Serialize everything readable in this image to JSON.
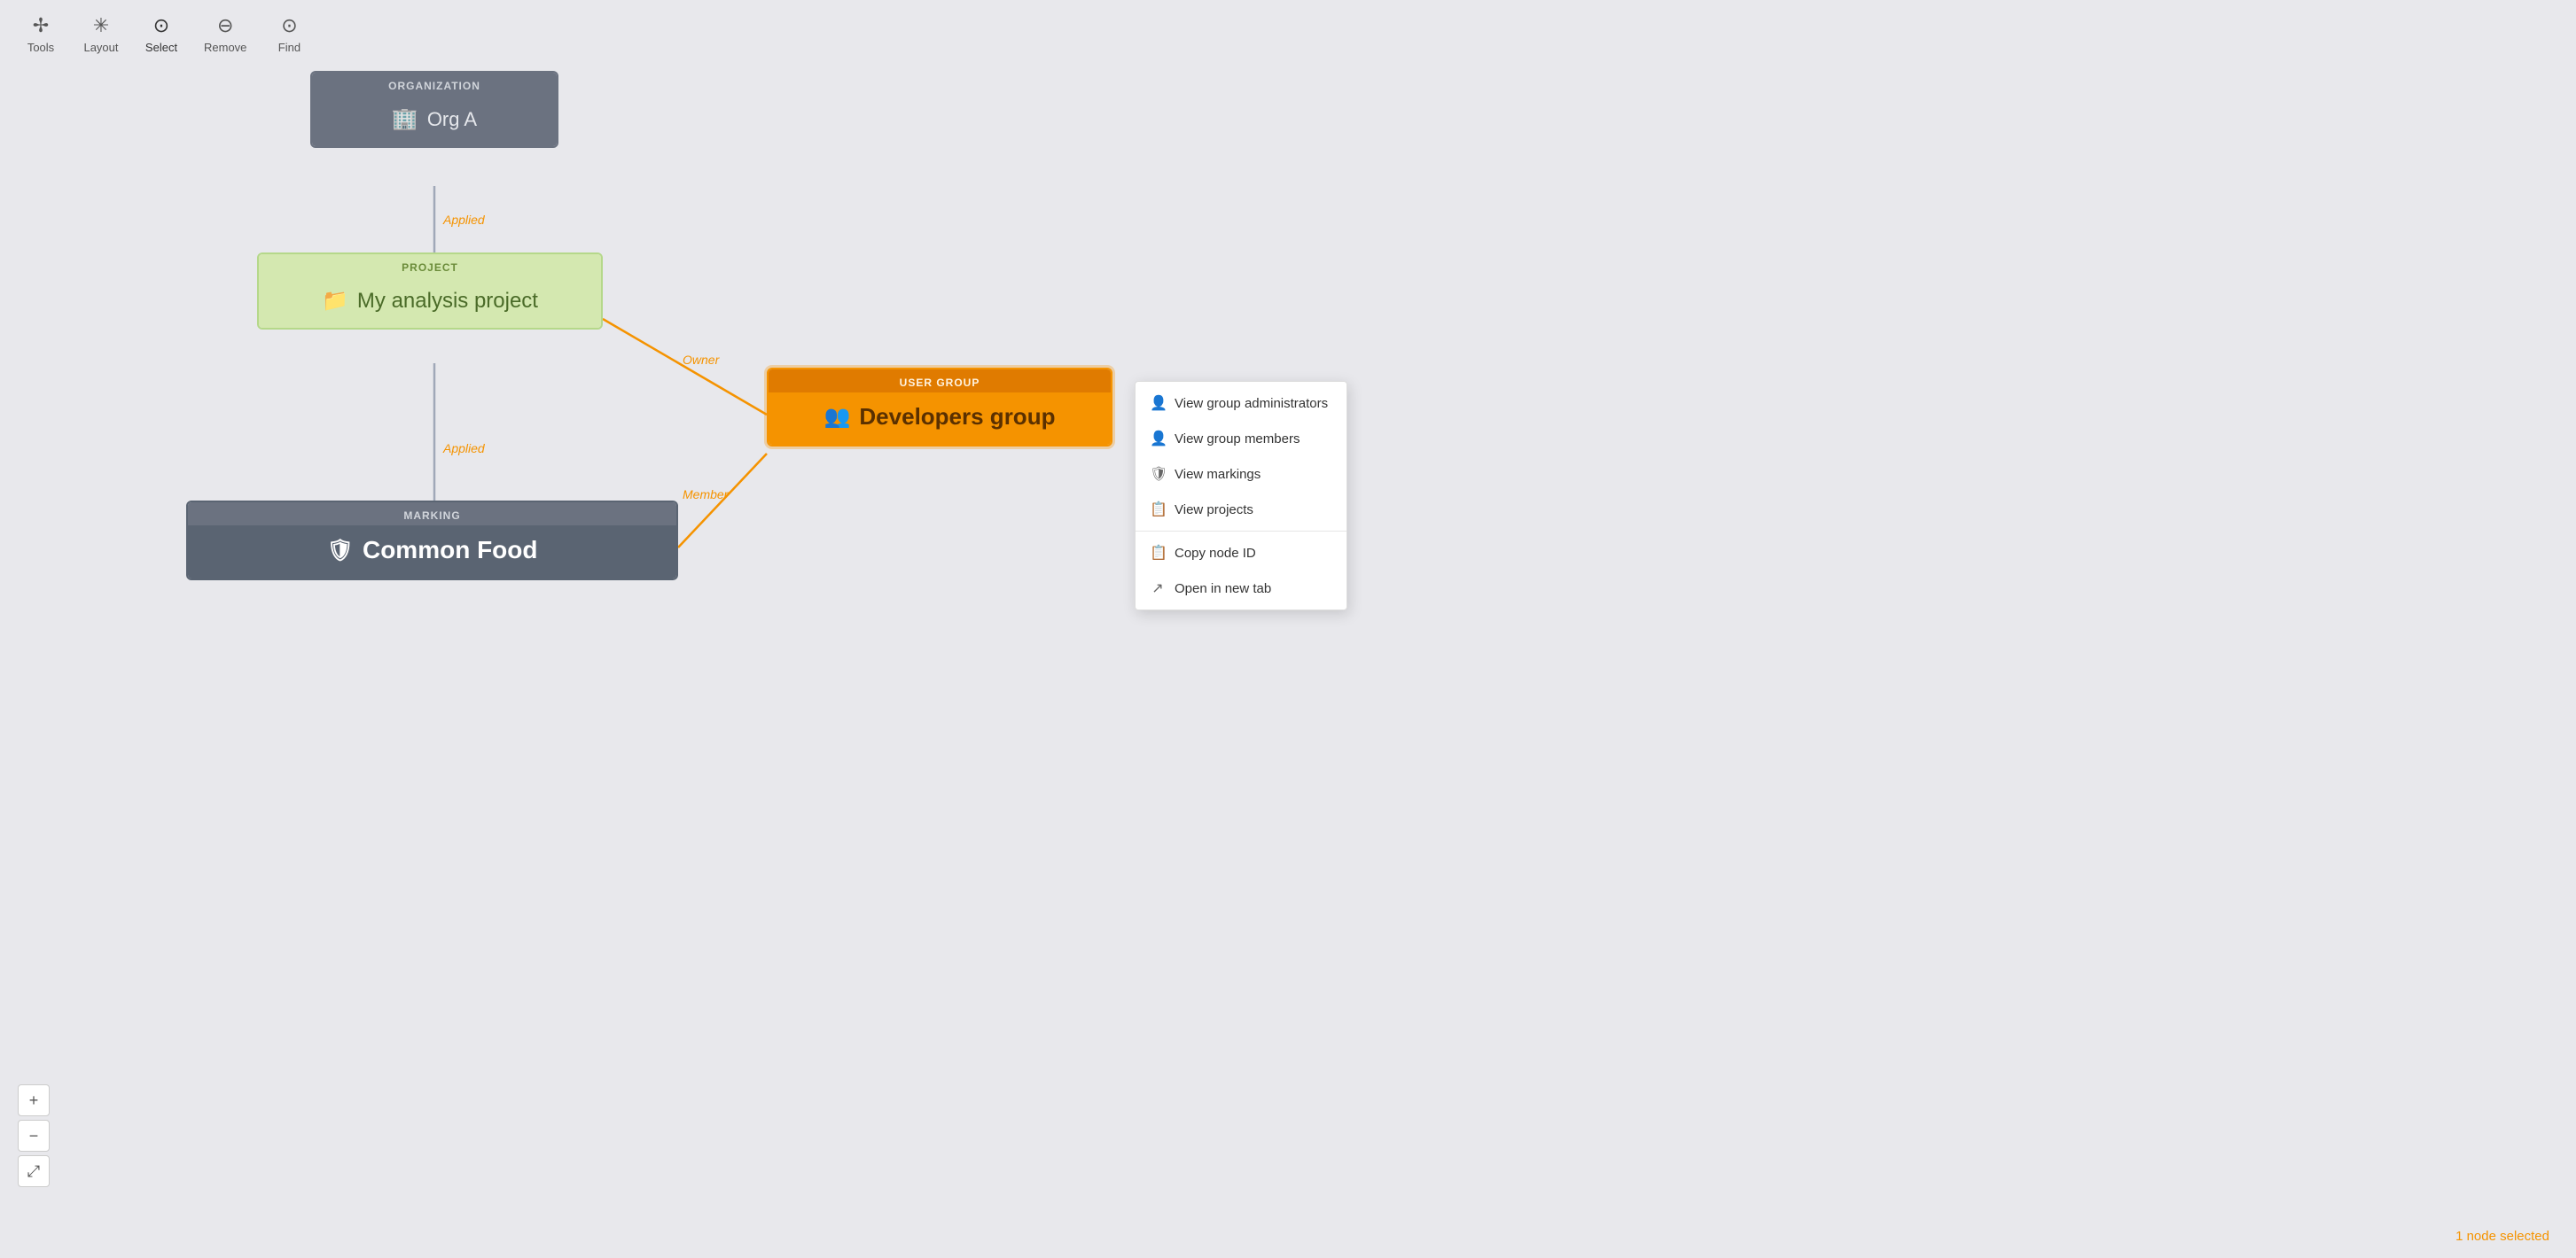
{
  "toolbar": {
    "tools_label": "Tools",
    "layout_label": "Layout",
    "select_label": "Select",
    "remove_label": "Remove",
    "find_label": "Find"
  },
  "nodes": {
    "org": {
      "header": "ORGANIZATION",
      "icon": "🏢",
      "name": "Org A"
    },
    "project": {
      "header": "PROJECT",
      "icon": "📁",
      "name": "My analysis project"
    },
    "marking": {
      "header": "MARKING",
      "icon": "🛡",
      "name": "Common Food"
    },
    "usergroup": {
      "header": "USER GROUP",
      "icon": "👥",
      "name": "Developers group"
    }
  },
  "edge_labels": {
    "applied1": "Applied",
    "owner": "Owner",
    "applied2": "Applied",
    "member": "Member"
  },
  "context_menu": {
    "items": [
      {
        "id": "view-admins",
        "icon": "👤",
        "label": "View group administrators"
      },
      {
        "id": "view-members",
        "icon": "👤",
        "label": "View group members"
      },
      {
        "id": "view-markings",
        "icon": "🛡",
        "label": "View markings"
      },
      {
        "id": "view-projects",
        "icon": "📋",
        "label": "View projects"
      },
      {
        "id": "copy-node-id",
        "icon": "📋",
        "label": "Copy node ID"
      },
      {
        "id": "open-new-tab",
        "icon": "↗",
        "label": "Open in new tab"
      }
    ]
  },
  "status": {
    "text": "1 node selected"
  }
}
